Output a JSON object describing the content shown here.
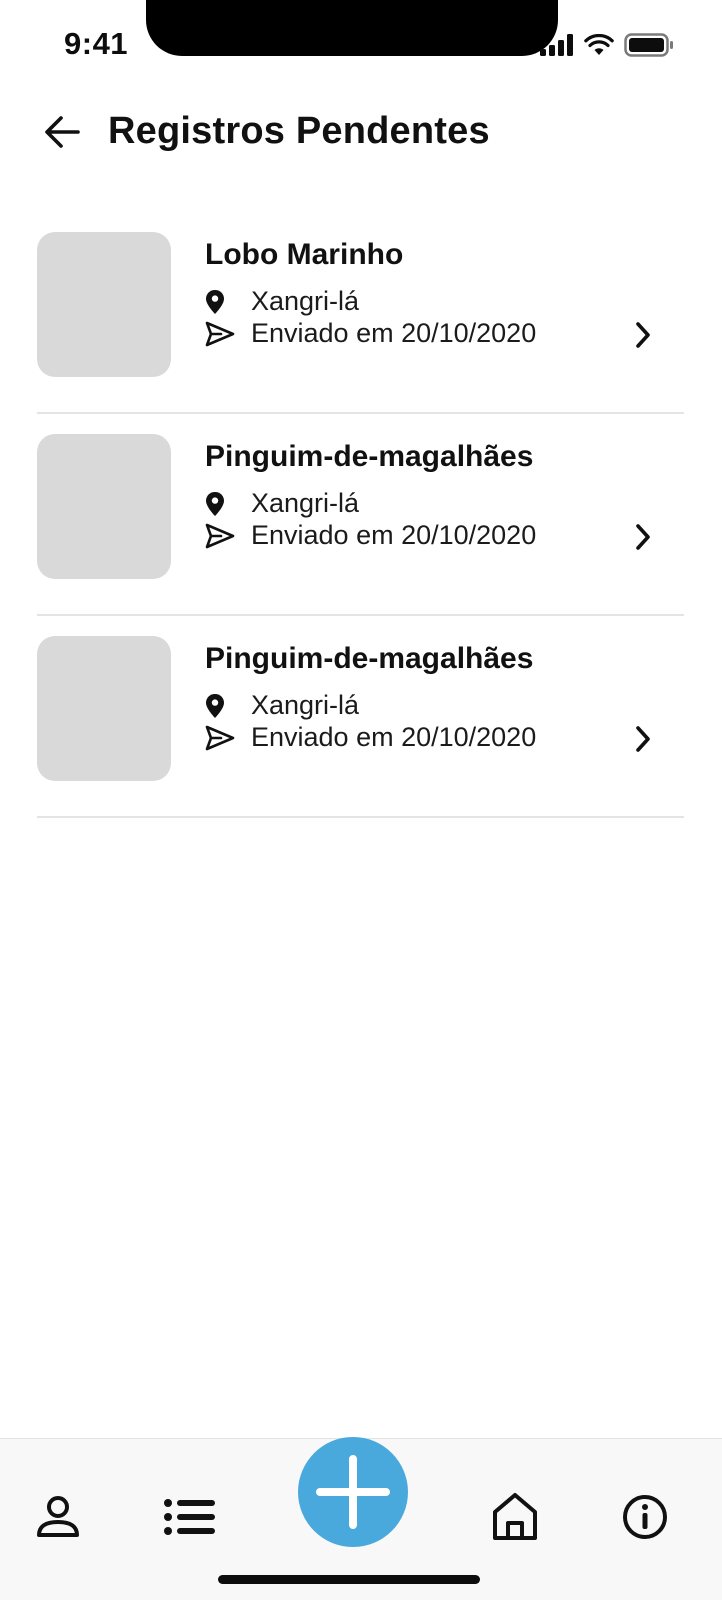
{
  "status_bar": {
    "time": "9:41"
  },
  "header": {
    "title": "Registros Pendentes"
  },
  "records": [
    {
      "name": "Lobo Marinho",
      "location": "Xangri-lá",
      "sent": "Enviado em 20/10/2020"
    },
    {
      "name": "Pinguim-de-magalhães",
      "location": "Xangri-lá",
      "sent": "Enviado em 20/10/2020"
    },
    {
      "name": "Pinguim-de-magalhães",
      "location": "Xangri-lá",
      "sent": "Enviado em 20/10/2020"
    }
  ],
  "icons": {
    "back": "arrow-left-icon",
    "location": "map-pin-icon",
    "sent": "send-icon",
    "chevron": "chevron-right-icon",
    "profile": "user-icon",
    "list": "list-icon",
    "add": "plus-icon",
    "home": "home-icon",
    "info": "info-icon"
  },
  "colors": {
    "accent": "#4aa9dc",
    "thumbnail": "#d9d9d9",
    "text": "#111111",
    "divider": "#e4e4e4"
  }
}
